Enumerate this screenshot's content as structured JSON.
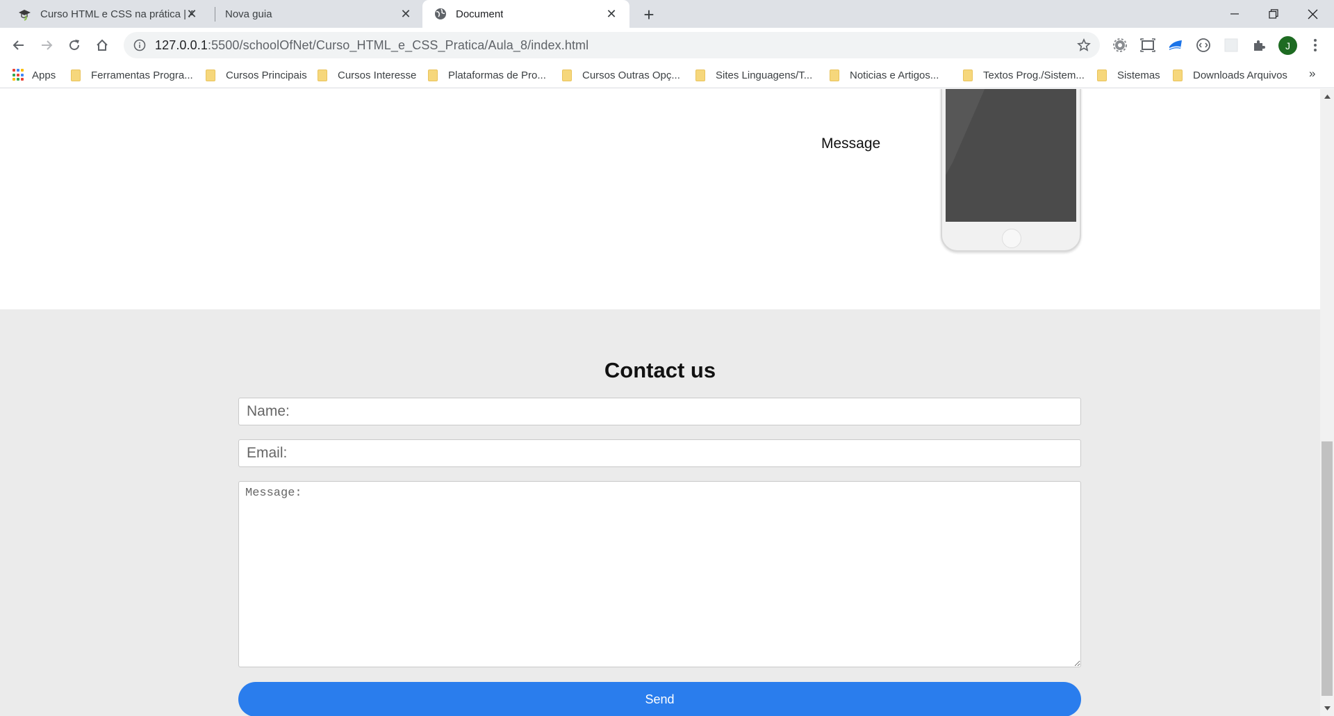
{
  "tabs": [
    {
      "title": "Curso HTML e CSS na prática | Au",
      "icon": "school-of-net-icon",
      "active": false
    },
    {
      "title": "Nova guia",
      "icon": "",
      "active": false
    },
    {
      "title": "Document",
      "icon": "globe-icon",
      "active": true
    }
  ],
  "address_bar": {
    "host": "127.0.0.1",
    "rest": ":5500/schoolOfNet/Curso_HTML_e_CSS_Pratica/Aula_8/index.html"
  },
  "profile_initial": "J",
  "bookmarks": {
    "apps_label": "Apps",
    "items": [
      "Ferramentas Progra...",
      "Cursos Principais",
      "Cursos Interesse",
      "Plataformas de Pro...",
      "Cursos Outras Opç...",
      "Sites Linguagens/T...",
      "Noticias e Artigos...",
      "Textos Prog./Sistem...",
      "Sistemas",
      "Downloads Arquivos"
    ],
    "more": "»"
  },
  "page": {
    "message_label": "Message",
    "contact": {
      "title": "Contact us",
      "name_placeholder": "Name:",
      "email_placeholder": "Email:",
      "message_placeholder": "Message:",
      "send_label": "Send"
    }
  },
  "colors": {
    "tabstrip": "#dee1e6",
    "contact_bg": "#ebebeb",
    "send_button": "#2a7ded",
    "profile": "#1e6b22"
  }
}
